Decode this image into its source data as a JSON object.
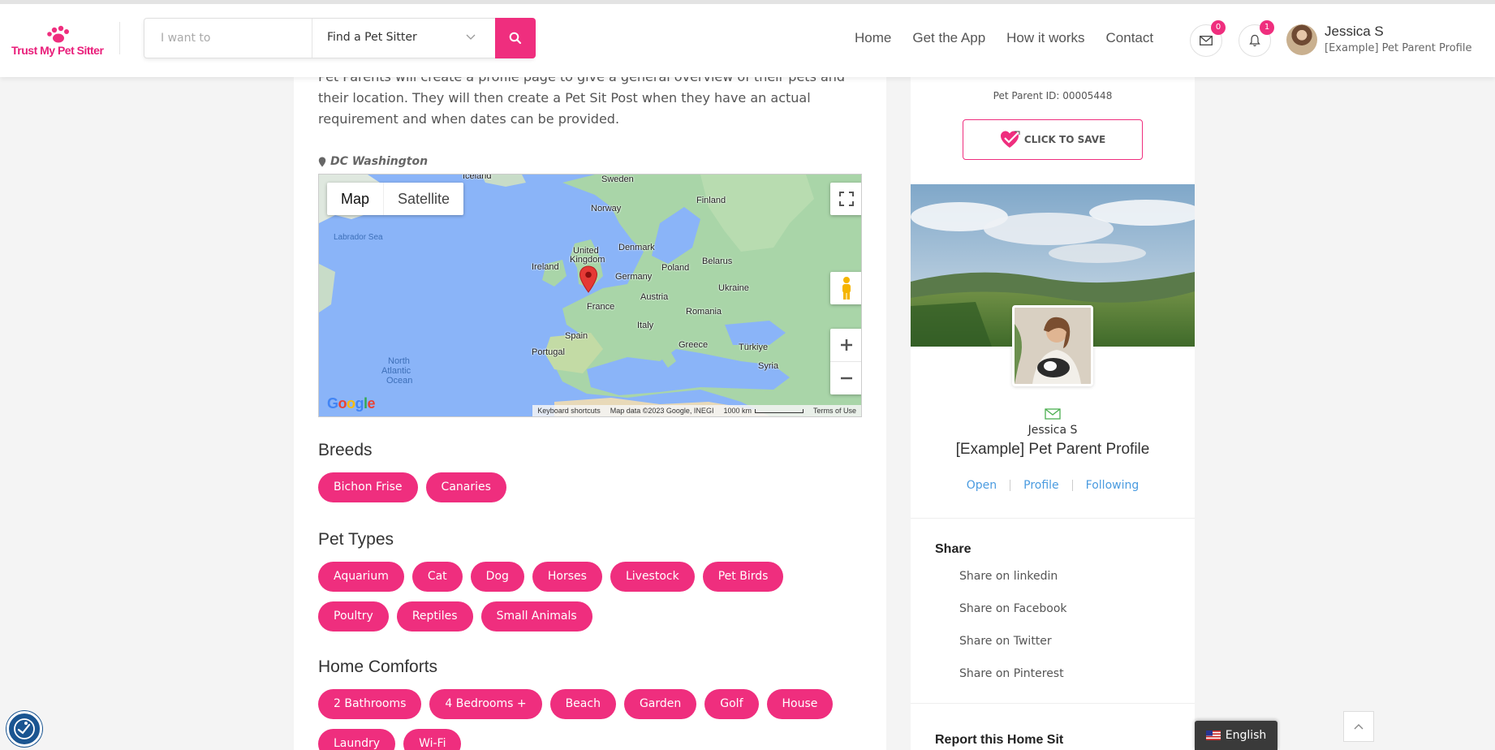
{
  "brand": {
    "logo_text": "Trust My Pet Sitter"
  },
  "search": {
    "placeholder": "I want to",
    "selected_option": "Find a Pet Sitter"
  },
  "nav": {
    "items": [
      "Home",
      "Get the App",
      "How it works",
      "Contact"
    ]
  },
  "header_icons": {
    "messages_count": "0",
    "notifications_count": "1"
  },
  "user": {
    "name": "Jessica S",
    "subtitle": "[Example] Pet Parent Profile"
  },
  "main": {
    "description": "Pet Parents will create a profile page to give a general overview of their pets and their location.  They will then create a Pet Sit Post when they have an actual requirement and when dates can be provided.",
    "location": "DC Washington",
    "map": {
      "type_map": "Map",
      "type_satellite": "Satellite",
      "labels": {
        "iceland": "Iceland",
        "sweden": "Sweden",
        "finland": "Finland",
        "norway": "Norway",
        "labrador": "Labrador Sea",
        "united": "United",
        "kingdom": "Kingdom",
        "denmark": "Denmark",
        "ireland": "Ireland",
        "belarus": "Belarus",
        "poland": "Poland",
        "germany": "Germany",
        "ukraine": "Ukraine",
        "austria": "Austria",
        "france": "France",
        "romania": "Romania",
        "italy": "Italy",
        "spain": "Spain",
        "greece": "Greece",
        "turkiye": "Türkiye",
        "portugal": "Portugal",
        "syria": "Syria",
        "atlantic1": "North",
        "atlantic2": "Atlantic",
        "atlantic3": "Ocean"
      },
      "footer": {
        "shortcuts": "Keyboard shortcuts",
        "data": "Map data ©2023 Google, INEGI",
        "scale": "1000 km",
        "terms": "Terms of Use"
      },
      "google": "Google"
    },
    "breeds_title": "Breeds",
    "breeds": [
      "Bichon Frise",
      "Canaries"
    ],
    "pet_types_title": "Pet Types",
    "pet_types": [
      "Aquarium",
      "Cat",
      "Dog",
      "Horses",
      "Livestock",
      "Pet Birds",
      "Poultry",
      "Reptiles",
      "Small Animals"
    ],
    "home_comforts_title": "Home Comforts",
    "home_comforts": [
      "2 Bathrooms",
      "4 Bedrooms +",
      "Beach",
      "Garden",
      "Golf",
      "House",
      "Laundry",
      "Wi-Fi"
    ]
  },
  "sidebar": {
    "pet_parent_id": "Pet Parent ID: 00005448",
    "save_label": "CLICK TO SAVE",
    "name": "Jessica S",
    "title": "[Example] Pet Parent Profile",
    "links": [
      "Open",
      "Profile",
      "Following"
    ],
    "share_title": "Share",
    "share_items": [
      "Share on linkedin",
      "Share on Facebook",
      "Share on Twitter",
      "Share on Pinterest"
    ],
    "report_title": "Report this Home Sit"
  },
  "language": {
    "label": "English"
  },
  "colors": {
    "accent": "#ef2e7e",
    "link": "#4a9be0",
    "access": "#1a5591"
  }
}
